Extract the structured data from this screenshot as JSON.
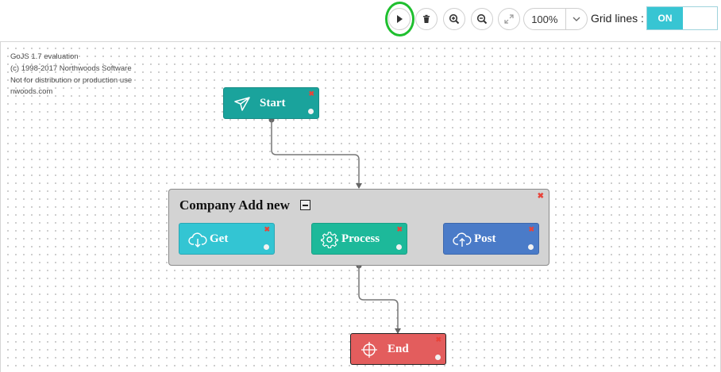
{
  "toolbar": {
    "play_icon": "play-icon",
    "delete_icon": "trash-icon",
    "zoom_in_icon": "zoom-in-icon",
    "zoom_out_icon": "zoom-out-icon",
    "fit_icon": "expand-icon",
    "zoom_level": "100%",
    "zoom_caret_icon": "chevron-down-icon",
    "grid_lines_label": "Grid lines :",
    "grid_toggle_value": "ON",
    "highlight_color": "#1fbf2f",
    "toggle_color": "#37c5d3"
  },
  "evaluation": {
    "line1": "GoJS 1.7 evaluation",
    "line2": "(c) 1998-2017 Northwoods Software",
    "line3": "Not for distribution or production use",
    "line4": "nwoods.com"
  },
  "nodes": {
    "start": {
      "label": "Start",
      "icon": "send-icon",
      "color": "#1aa39c"
    },
    "group": {
      "title": "Company Add new",
      "collapse_icon": "collapse-icon"
    },
    "get": {
      "label": "Get",
      "icon": "cloud-download-icon",
      "color": "#33c5d3"
    },
    "process": {
      "label": "Process",
      "icon": "gear-icon",
      "color": "#1db99a"
    },
    "post": {
      "label": "Post",
      "icon": "cloud-upload-icon",
      "color": "#4a7bc8"
    },
    "end": {
      "label": "End",
      "icon": "crosshair-icon",
      "color": "#e35d5d"
    }
  }
}
